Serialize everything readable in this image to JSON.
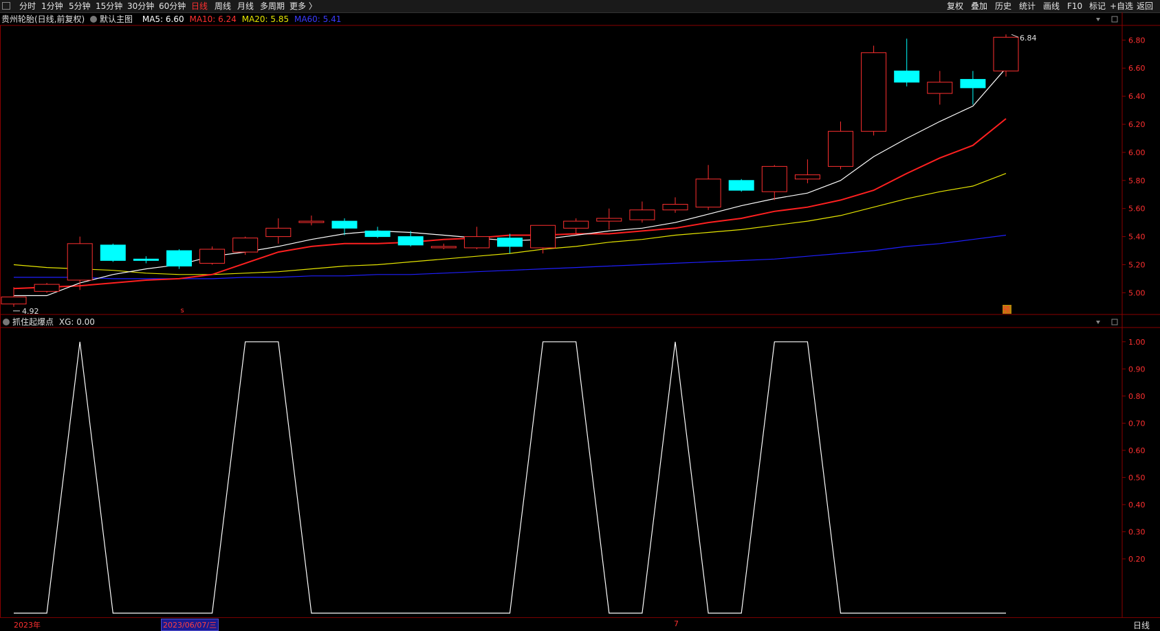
{
  "toolbar": {
    "left_tabs": [
      {
        "label": "分时",
        "active": false
      },
      {
        "label": "1分钟",
        "active": false
      },
      {
        "label": "5分钟",
        "active": false
      },
      {
        "label": "15分钟",
        "active": false
      },
      {
        "label": "30分钟",
        "active": false
      },
      {
        "label": "60分钟",
        "active": false
      },
      {
        "label": "日线",
        "active": true
      },
      {
        "label": "周线",
        "active": false
      },
      {
        "label": "月线",
        "active": false
      },
      {
        "label": "多周期",
        "active": false
      },
      {
        "label": "更多",
        "active": false
      }
    ],
    "right_tabs": [
      "复权",
      "叠加",
      "历史",
      "统计",
      "画线",
      "F10",
      "标记",
      "+自选",
      "返回"
    ]
  },
  "main_panel": {
    "title": "贵州轮胎(日线,前复权)",
    "template": "默认主图",
    "ma5": "MA5: 6.60",
    "ma10": "MA10: 6.24",
    "ma20": "MA20: 5.85",
    "ma60": "MA60: 5.41",
    "high_label": "6.84",
    "low_label": "4.92",
    "marker_s": "s",
    "marker_yu": "预"
  },
  "sub_panel": {
    "title": "抓住起爆点",
    "xg": "XG: 0.00"
  },
  "bottom": {
    "year": "2023年",
    "cursor_date": "2023/06/07/三",
    "month_mark": "7",
    "period": "日线"
  },
  "colors": {
    "up": "#ff3030",
    "down": "#00ffff",
    "ma5": "#ffffff",
    "ma10": "#ff2020",
    "ma20": "#e6e600",
    "ma60": "#1f1fff",
    "axis": "#8b0000",
    "active_tab": "#ff3030"
  },
  "chart_data": [
    {
      "type": "candlestick",
      "ylim": [
        4.86,
        6.88
      ],
      "y_ticks": [
        "6.80",
        "6.60",
        "6.40",
        "6.20",
        "6.00",
        "5.80",
        "5.60",
        "5.40",
        "5.20",
        "5.00"
      ],
      "candles": [
        {
          "o": 4.92,
          "h": 5.04,
          "l": 4.9,
          "c": 4.97
        },
        {
          "o": 5.01,
          "h": 5.07,
          "l": 5.0,
          "c": 5.06
        },
        {
          "o": 5.09,
          "h": 5.4,
          "l": 5.02,
          "c": 5.35
        },
        {
          "o": 5.34,
          "h": 5.35,
          "l": 5.22,
          "c": 5.23
        },
        {
          "o": 5.24,
          "h": 5.26,
          "l": 5.21,
          "c": 5.23
        },
        {
          "o": 5.3,
          "h": 5.31,
          "l": 5.17,
          "c": 5.19
        },
        {
          "o": 5.21,
          "h": 5.33,
          "l": 5.2,
          "c": 5.31
        },
        {
          "o": 5.29,
          "h": 5.4,
          "l": 5.27,
          "c": 5.39
        },
        {
          "o": 5.4,
          "h": 5.53,
          "l": 5.35,
          "c": 5.46
        },
        {
          "o": 5.5,
          "h": 5.55,
          "l": 5.48,
          "c": 5.51
        },
        {
          "o": 5.51,
          "h": 5.53,
          "l": 5.41,
          "c": 5.46
        },
        {
          "o": 5.44,
          "h": 5.47,
          "l": 5.39,
          "c": 5.4
        },
        {
          "o": 5.4,
          "h": 5.44,
          "l": 5.33,
          "c": 5.34
        },
        {
          "o": 5.32,
          "h": 5.35,
          "l": 5.31,
          "c": 5.33
        },
        {
          "o": 5.32,
          "h": 5.47,
          "l": 5.31,
          "c": 5.4
        },
        {
          "o": 5.39,
          "h": 5.42,
          "l": 5.28,
          "c": 5.33
        },
        {
          "o": 5.32,
          "h": 5.48,
          "l": 5.28,
          "c": 5.48
        },
        {
          "o": 5.46,
          "h": 5.53,
          "l": 5.42,
          "c": 5.51
        },
        {
          "o": 5.51,
          "h": 5.6,
          "l": 5.45,
          "c": 5.53
        },
        {
          "o": 5.52,
          "h": 5.65,
          "l": 5.5,
          "c": 5.59
        },
        {
          "o": 5.59,
          "h": 5.68,
          "l": 5.57,
          "c": 5.63
        },
        {
          "o": 5.61,
          "h": 5.91,
          "l": 5.59,
          "c": 5.81
        },
        {
          "o": 5.8,
          "h": 5.81,
          "l": 5.72,
          "c": 5.73
        },
        {
          "o": 5.72,
          "h": 5.91,
          "l": 5.66,
          "c": 5.9
        },
        {
          "o": 5.81,
          "h": 5.95,
          "l": 5.78,
          "c": 5.84
        },
        {
          "o": 5.9,
          "h": 6.22,
          "l": 5.88,
          "c": 6.15
        },
        {
          "o": 6.15,
          "h": 6.76,
          "l": 6.12,
          "c": 6.71
        },
        {
          "o": 6.58,
          "h": 6.81,
          "l": 6.47,
          "c": 6.5
        },
        {
          "o": 6.42,
          "h": 6.58,
          "l": 6.34,
          "c": 6.5
        },
        {
          "o": 6.52,
          "h": 6.58,
          "l": 6.34,
          "c": 6.46
        },
        {
          "o": 6.58,
          "h": 6.84,
          "l": 6.54,
          "c": 6.82
        }
      ],
      "ma5": [
        4.98,
        4.98,
        5.07,
        5.13,
        5.17,
        5.2,
        5.26,
        5.29,
        5.33,
        5.38,
        5.42,
        5.44,
        5.43,
        5.41,
        5.39,
        5.37,
        5.38,
        5.41,
        5.44,
        5.46,
        5.5,
        5.56,
        5.62,
        5.67,
        5.71,
        5.8,
        5.97,
        6.1,
        6.22,
        6.33,
        6.6
      ],
      "ma10": [
        5.03,
        5.04,
        5.05,
        5.07,
        5.09,
        5.1,
        5.13,
        5.21,
        5.29,
        5.33,
        5.35,
        5.35,
        5.36,
        5.38,
        5.39,
        5.41,
        5.41,
        5.42,
        5.42,
        5.44,
        5.46,
        5.5,
        5.53,
        5.58,
        5.61,
        5.66,
        5.73,
        5.85,
        5.96,
        6.05,
        6.24
      ],
      "ma20": [
        5.2,
        5.18,
        5.17,
        5.16,
        5.14,
        5.13,
        5.13,
        5.14,
        5.15,
        5.17,
        5.19,
        5.2,
        5.22,
        5.24,
        5.26,
        5.28,
        5.31,
        5.33,
        5.36,
        5.38,
        5.41,
        5.43,
        5.45,
        5.48,
        5.51,
        5.55,
        5.61,
        5.67,
        5.72,
        5.76,
        5.85
      ],
      "ma60": [
        5.11,
        5.11,
        5.11,
        5.1,
        5.1,
        5.1,
        5.1,
        5.11,
        5.11,
        5.12,
        5.12,
        5.13,
        5.13,
        5.14,
        5.15,
        5.16,
        5.17,
        5.18,
        5.19,
        5.2,
        5.21,
        5.22,
        5.23,
        5.24,
        5.26,
        5.28,
        5.3,
        5.33,
        5.35,
        5.38,
        5.41
      ]
    },
    {
      "type": "line",
      "series": [
        {
          "name": "XG",
          "values": [
            0,
            0,
            1,
            0,
            0,
            0,
            0,
            1,
            1,
            0,
            0,
            0,
            0,
            0,
            0,
            0,
            1,
            1,
            0,
            0,
            1,
            0,
            0,
            1,
            1,
            0,
            0,
            0,
            0,
            0,
            0
          ]
        }
      ],
      "ylim": [
        0,
        1.05
      ],
      "y_ticks": [
        "1.00",
        "0.90",
        "0.80",
        "0.70",
        "0.60",
        "0.50",
        "0.40",
        "0.30",
        "0.20"
      ]
    }
  ]
}
